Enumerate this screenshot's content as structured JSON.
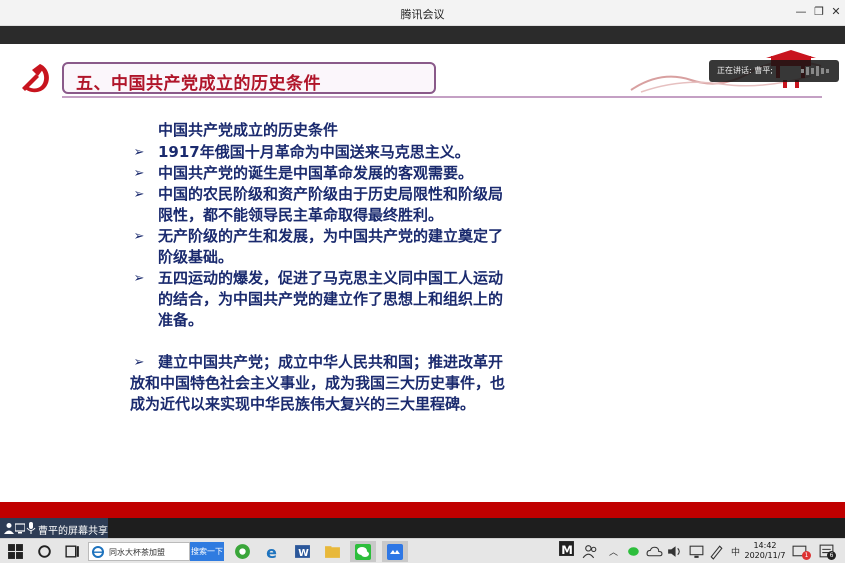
{
  "window": {
    "title": "腾讯会议"
  },
  "slide": {
    "title": "五、中国共产党成立的历史条件",
    "heading": "中国共产党成立的历史条件",
    "bullets": [
      {
        "lines": [
          "1917年俄国十月革命为中国送来马克思主义。"
        ]
      },
      {
        "lines": [
          "中国共产党的诞生是中国革命发展的客观需要。"
        ]
      },
      {
        "lines": [
          "中国的农民阶级和资产阶级由于历史局限性和阶级局",
          "限性，都不能领导民主革命取得最终胜利。"
        ]
      },
      {
        "lines": [
          "无产阶级的产生和发展，为中国共产党的建立奠定了",
          "阶级基础。"
        ]
      },
      {
        "lines": [
          "五四运动的爆发，促进了马克思主义同中国工人运动",
          "的结合，为中国共产党的建立作了思想上和组织上的",
          "准备。"
        ]
      }
    ],
    "final": {
      "lines": [
        "建立中国共产党；成立中华人民共和国；推进改革开",
        "放和中国特色社会主义事业，成为我国三大历史事件，也",
        "成为近代以来实现中华民族伟大复兴的三大里程碑。"
      ]
    },
    "arrow": "➢"
  },
  "speaking": {
    "label": "正在讲话: 曹平;"
  },
  "share": {
    "label": "曹平的屏幕共享"
  },
  "taskbar": {
    "search_text": "同水大杯茶加盟",
    "search_button": "搜索一下",
    "ime": "中",
    "time": "14:42",
    "date": "2020/11/7",
    "notif_count": "6",
    "msg_count": "1"
  },
  "colors": {
    "title_red": "#b0152a",
    "text_blue": "#1a2a6e",
    "bar_red": "#c00000"
  }
}
